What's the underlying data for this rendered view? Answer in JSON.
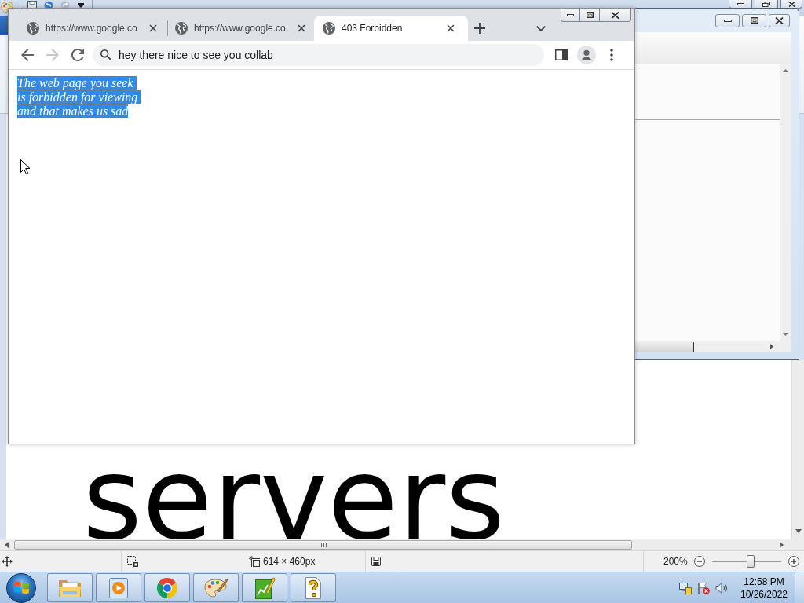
{
  "paint": {
    "canvas_text": "servers",
    "status_bar": {
      "image_size": "614 × 460px",
      "zoom": "200%",
      "zoom_slider": {
        "level": 0.56
      }
    }
  },
  "browser": {
    "tabs": [
      {
        "title": "https://www.google.co",
        "selected": false
      },
      {
        "title": "https://www.google.co",
        "selected": false
      },
      {
        "title": "403 Forbidden",
        "selected": true
      }
    ],
    "nav_buttons": [
      {
        "kind": "back",
        "disabled": false
      },
      {
        "kind": "forward",
        "disabled": true
      },
      {
        "kind": "reload",
        "disabled": false
      }
    ],
    "address_bar": {
      "value": "hey there nice to see you collab"
    },
    "page": {
      "lines": [
        "The web page you seek",
        "is forbidden for viewing",
        "and that makes us sad"
      ],
      "selected": true
    }
  },
  "taskbar": {
    "clock": {
      "time": "12:58 PM",
      "date": "10/26/2022"
    }
  }
}
